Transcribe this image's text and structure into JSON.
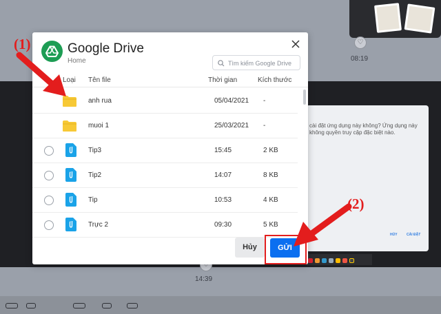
{
  "background": {
    "time_top": "08:19",
    "time_bottom": "14:39",
    "permission_text": "cài đặt ứng dụng này không? Ứng dụng này không quyền truy cập đặc biệt nào.",
    "permission_btn_1": "HỦY",
    "permission_btn_2": "CÀI ĐẶT"
  },
  "dialog": {
    "title": "Google Drive",
    "subtitle": "Home",
    "search_placeholder": "Tìm kiếm Google Drive",
    "columns": {
      "type": "Loại",
      "name": "Tên file",
      "time": "Thời gian",
      "size": "Kích thước"
    },
    "rows": [
      {
        "kind": "folder",
        "name": "anh rua",
        "time": "05/04/2021",
        "size": "-"
      },
      {
        "kind": "folder",
        "name": "muoi 1",
        "time": "25/03/2021",
        "size": "-"
      },
      {
        "kind": "file",
        "name": "Tip3",
        "time": "15:45",
        "size": "2 KB"
      },
      {
        "kind": "file",
        "name": "Tip2",
        "time": "14:07",
        "size": "8 KB"
      },
      {
        "kind": "file",
        "name": "Tip",
        "time": "10:53",
        "size": "4 KB"
      },
      {
        "kind": "file",
        "name": "Trực 2",
        "time": "09:30",
        "size": "5 KB"
      }
    ],
    "cancel_label": "Hủy",
    "send_label": "GỬI"
  },
  "annotations": {
    "label_1": "(1)",
    "label_2": "(2)",
    "color": "#e31d1d"
  },
  "colors": {
    "accent": "#0b6ff0",
    "drive_green": "#1d9d54",
    "folder": "#f7c936",
    "file": "#1aa3e8"
  }
}
